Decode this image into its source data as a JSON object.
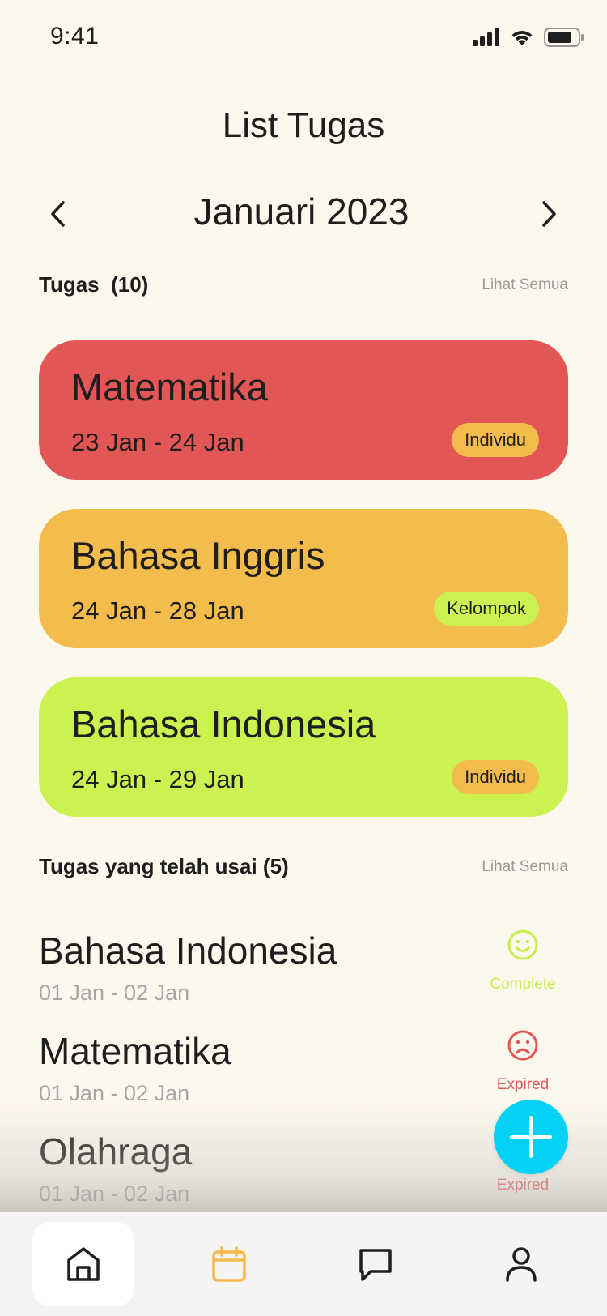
{
  "status_bar": {
    "time": "9:41"
  },
  "header": {
    "title": "List Tugas"
  },
  "month_nav": {
    "label": "Januari 2023"
  },
  "tasks_section": {
    "title": "Tugas  (10)",
    "see_all": "Lihat Semua"
  },
  "tasks": [
    {
      "name": "Matematika",
      "dates": "23 Jan - 24 Jan",
      "badge": "Individu",
      "color": "#E35656",
      "badge_color": "#F3BA4C"
    },
    {
      "name": "Bahasa Inggris",
      "dates": "24 Jan - 28 Jan",
      "badge": "Kelompok",
      "color": "#F3BC4D",
      "badge_color": "#CBF251"
    },
    {
      "name": "Bahasa Indonesia",
      "dates": "24 Jan - 29 Jan",
      "badge": "Individu",
      "color": "#CBF251",
      "badge_color": "#F3BA4C"
    }
  ],
  "done_section": {
    "title": "Tugas yang telah usai (5)",
    "see_all": "Lihat Semua"
  },
  "done_tasks": [
    {
      "name": "Bahasa Indonesia",
      "dates": "01 Jan - 02 Jan",
      "status": "Complete",
      "icon": "smile-icon",
      "status_color": "#C5EE4C"
    },
    {
      "name": "Matematika",
      "dates": "01 Jan - 02 Jan",
      "status": "Expired",
      "icon": "frown-icon",
      "status_color": "#E35656"
    },
    {
      "name": "Olahraga",
      "dates": "01 Jan - 02 Jan",
      "status": "Expired",
      "icon": "frown-icon",
      "status_color": "#E35656"
    }
  ],
  "fab": {
    "icon": "plus-icon",
    "color": "#00D1F5"
  },
  "bottom_nav": [
    {
      "id": "home",
      "icon": "home-icon",
      "active": true
    },
    {
      "id": "calendar",
      "icon": "calendar-icon",
      "active": false,
      "color": "#F3BA4C"
    },
    {
      "id": "chat",
      "icon": "chat-icon",
      "active": false
    },
    {
      "id": "profile",
      "icon": "profile-icon",
      "active": false
    }
  ]
}
